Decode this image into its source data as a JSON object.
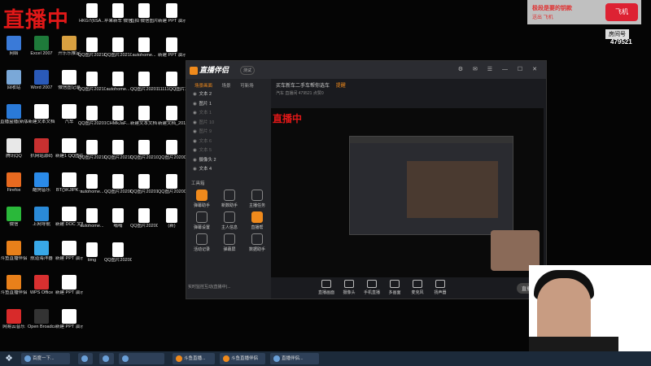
{
  "overlay": {
    "live_title": "直播中"
  },
  "desktop_icons": [
    {
      "label": "网络",
      "color": "#3a7ad8"
    },
    {
      "label": "Excel 2007",
      "color": "#1e7a3a"
    },
    {
      "label": "开乐乐推定",
      "color": "#d8a040"
    },
    {
      "label": "回收站",
      "color": "#7aa8d8"
    },
    {
      "label": "Word 2007",
      "color": "#2a5ab8"
    },
    {
      "label": "微信图记录",
      "color": "#ffffff"
    },
    {
      "label": "直播盒播(新版)",
      "color": "#2a7ad8"
    },
    {
      "label": "新建文本文档",
      "color": "#ffffff"
    },
    {
      "label": "汽车",
      "color": "#ffffff"
    },
    {
      "label": "腾讯QQ",
      "color": "#e8e8e8"
    },
    {
      "label": "扒网站源码",
      "color": "#c83030"
    },
    {
      "label": "新建1 QQ图片2019072...",
      "color": "#ffffff"
    },
    {
      "label": "Firefox",
      "color": "#e86a20"
    },
    {
      "label": "酷狗音乐",
      "color": "#2a8ae8"
    },
    {
      "label": "BT()\\KJIPK...",
      "color": "#ffffff"
    },
    {
      "label": "微信",
      "color": "#2ab83a"
    },
    {
      "label": "上网导航",
      "color": "#2a8ad8"
    },
    {
      "label": "新建 DOC 文档",
      "color": "#ffffff"
    },
    {
      "label": "斗鱼直播伴侣",
      "color": "#e8801a"
    },
    {
      "label": "航道海洋器",
      "color": "#38a8e8"
    },
    {
      "label": "新建 PPT 演示文稿",
      "color": "#ffffff"
    },
    {
      "label": "斗鱼直播伴侣",
      "color": "#e8801a"
    },
    {
      "label": "WPS Office",
      "color": "#d83030"
    },
    {
      "label": "新建 PPT 演示文稿",
      "color": "#ffffff"
    },
    {
      "label": "网易云音乐",
      "color": "#d82a2a"
    },
    {
      "label": "Open Broadcast...",
      "color": "#333333"
    },
    {
      "label": "新建 PPT 演示文稿",
      "color": "#ffffff"
    }
  ],
  "desktop_icons_col2": [
    {
      "label": "HKG7(6SA...",
      "color": "#ffffff"
    },
    {
      "label": "苹果新车 微信图片_2019...",
      "color": "#ffffff"
    },
    {
      "label": "直拍 微信图片_20201...",
      "color": "#ffffff"
    },
    {
      "label": "新建 PPT 演示文档 (7)...",
      "color": "#ffffff"
    },
    {
      "label": "QQ图片20210717...",
      "color": "#ffffff"
    },
    {
      "label": "QQ图片20210717...",
      "color": "#ffffff"
    },
    {
      "label": "autohome...",
      "color": "#ffffff"
    },
    {
      "label": "新建 PPT 演示文档",
      "color": "#ffffff"
    },
    {
      "label": "QQ图片20210717...",
      "color": "#ffffff"
    },
    {
      "label": "autohome...",
      "color": "#ffffff"
    },
    {
      "label": "QQ图片20201...",
      "color": "#ffffff"
    },
    {
      "label": "11111QQ图片2019070...",
      "color": "#ffffff"
    },
    {
      "label": "QQ图片20201...",
      "color": "#ffffff"
    },
    {
      "label": "CHMkJaF...",
      "color": "#ffffff"
    },
    {
      "label": "新建文本文档 (2)",
      "color": "#ffffff"
    },
    {
      "label": "新建文档_2019...",
      "color": "#ffffff"
    },
    {
      "label": "QQ图片2021070...",
      "color": "#ffffff"
    },
    {
      "label": "QQ图片20210...",
      "color": "#ffffff"
    },
    {
      "label": "QQ图片20210...",
      "color": "#ffffff"
    },
    {
      "label": "QQ图片20200...",
      "color": "#ffffff"
    },
    {
      "label": "autohome...",
      "color": "#ffffff"
    },
    {
      "label": "QQ图片20200...",
      "color": "#ffffff"
    },
    {
      "label": "QQ图片20201...",
      "color": "#ffffff"
    },
    {
      "label": "QQ图片20200...",
      "color": "#ffffff"
    },
    {
      "label": "autohome...",
      "color": "#ffffff"
    },
    {
      "label": "嗡嗡",
      "color": "#ffffff"
    },
    {
      "label": "QQ图片20200...",
      "color": "#ffffff"
    },
    {
      "label": "(新)",
      "color": "#ffffff"
    },
    {
      "label": "timg",
      "color": "#ffffff"
    },
    {
      "label": "QQ图片20200...",
      "color": "#ffffff"
    }
  ],
  "app": {
    "logo": "直播伴侣",
    "version": "测试",
    "scene_tabs": [
      "场景画面",
      "场景",
      "可新场"
    ],
    "layers": [
      "文本 2",
      "图片 1",
      "文本 1",
      "图片 10",
      "图片 9",
      "文本 6",
      "文本 5",
      "摄像头 2",
      "文本 4"
    ],
    "tools_header": "工具箱",
    "tools": [
      "弹幕助手",
      "新数助手",
      "主播任务",
      "弹幕设置",
      "主人信息",
      "直播帮",
      "活动记录",
      "弹幕屏",
      "数据助手"
    ],
    "room_title": "买车新车二手车帮你选车",
    "room_tag": "提醒",
    "room_meta": "汽车  直播间  479521  点赞0",
    "preview_live_text": "直播中",
    "bottom_tools": [
      "直播画面",
      "摄像头",
      "手机直播",
      "多画面",
      "麦克风",
      "扬声器"
    ],
    "live_button": "直播中",
    "bottom_note": "实时监控互动(直播中)..."
  },
  "right": {
    "gift_title": "极段是要的钥款",
    "gift_sub": "送出 飞机",
    "gift_badge": "飞机",
    "room_label": "房间号",
    "room_number": "479521"
  },
  "taskbar": {
    "items": [
      "百度一下...",
      "",
      "",
      "",
      "斗鱼直播...",
      "斗鱼直播伴侣",
      "直播伴侣..."
    ]
  }
}
